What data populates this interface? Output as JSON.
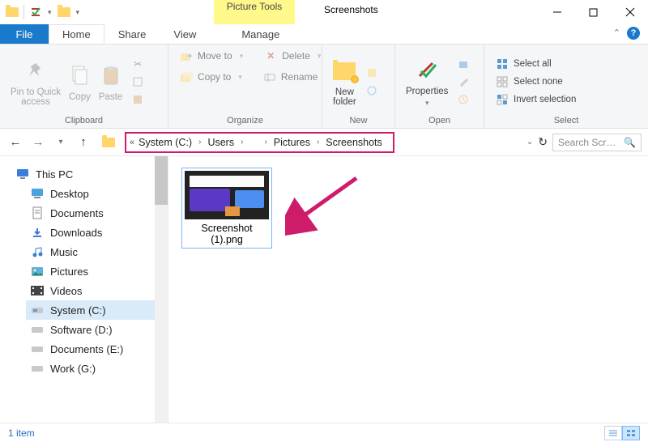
{
  "window": {
    "context_tab": "Picture Tools",
    "title": "Screenshots"
  },
  "tabs": {
    "file": "File",
    "home": "Home",
    "share": "Share",
    "view": "View",
    "manage": "Manage"
  },
  "ribbon": {
    "clipboard": {
      "label": "Clipboard",
      "pin": "Pin to Quick\naccess",
      "copy": "Copy",
      "paste": "Paste"
    },
    "organize": {
      "label": "Organize",
      "move": "Move to",
      "copy": "Copy to",
      "delete": "Delete",
      "rename": "Rename"
    },
    "new": {
      "label": "New",
      "folder": "New\nfolder"
    },
    "open": {
      "label": "Open",
      "properties": "Properties"
    },
    "select": {
      "label": "Select",
      "all": "Select all",
      "none": "Select none",
      "invert": "Invert selection"
    }
  },
  "breadcrumb": {
    "seg1": "System (C:)",
    "seg2": "Users",
    "seg3_hidden": " ",
    "seg4": "Pictures",
    "seg5": "Screenshots"
  },
  "search": {
    "placeholder": "Search Scr…"
  },
  "tree": {
    "root": "This PC",
    "items": [
      "Desktop",
      "Documents",
      "Downloads",
      "Music",
      "Pictures",
      "Videos",
      "System (C:)",
      "Software (D:)",
      "Documents (E:)",
      "Work (G:)"
    ]
  },
  "files": {
    "item1_name": "Screenshot\n(1).png"
  },
  "statusbar": {
    "count": "1 item"
  }
}
